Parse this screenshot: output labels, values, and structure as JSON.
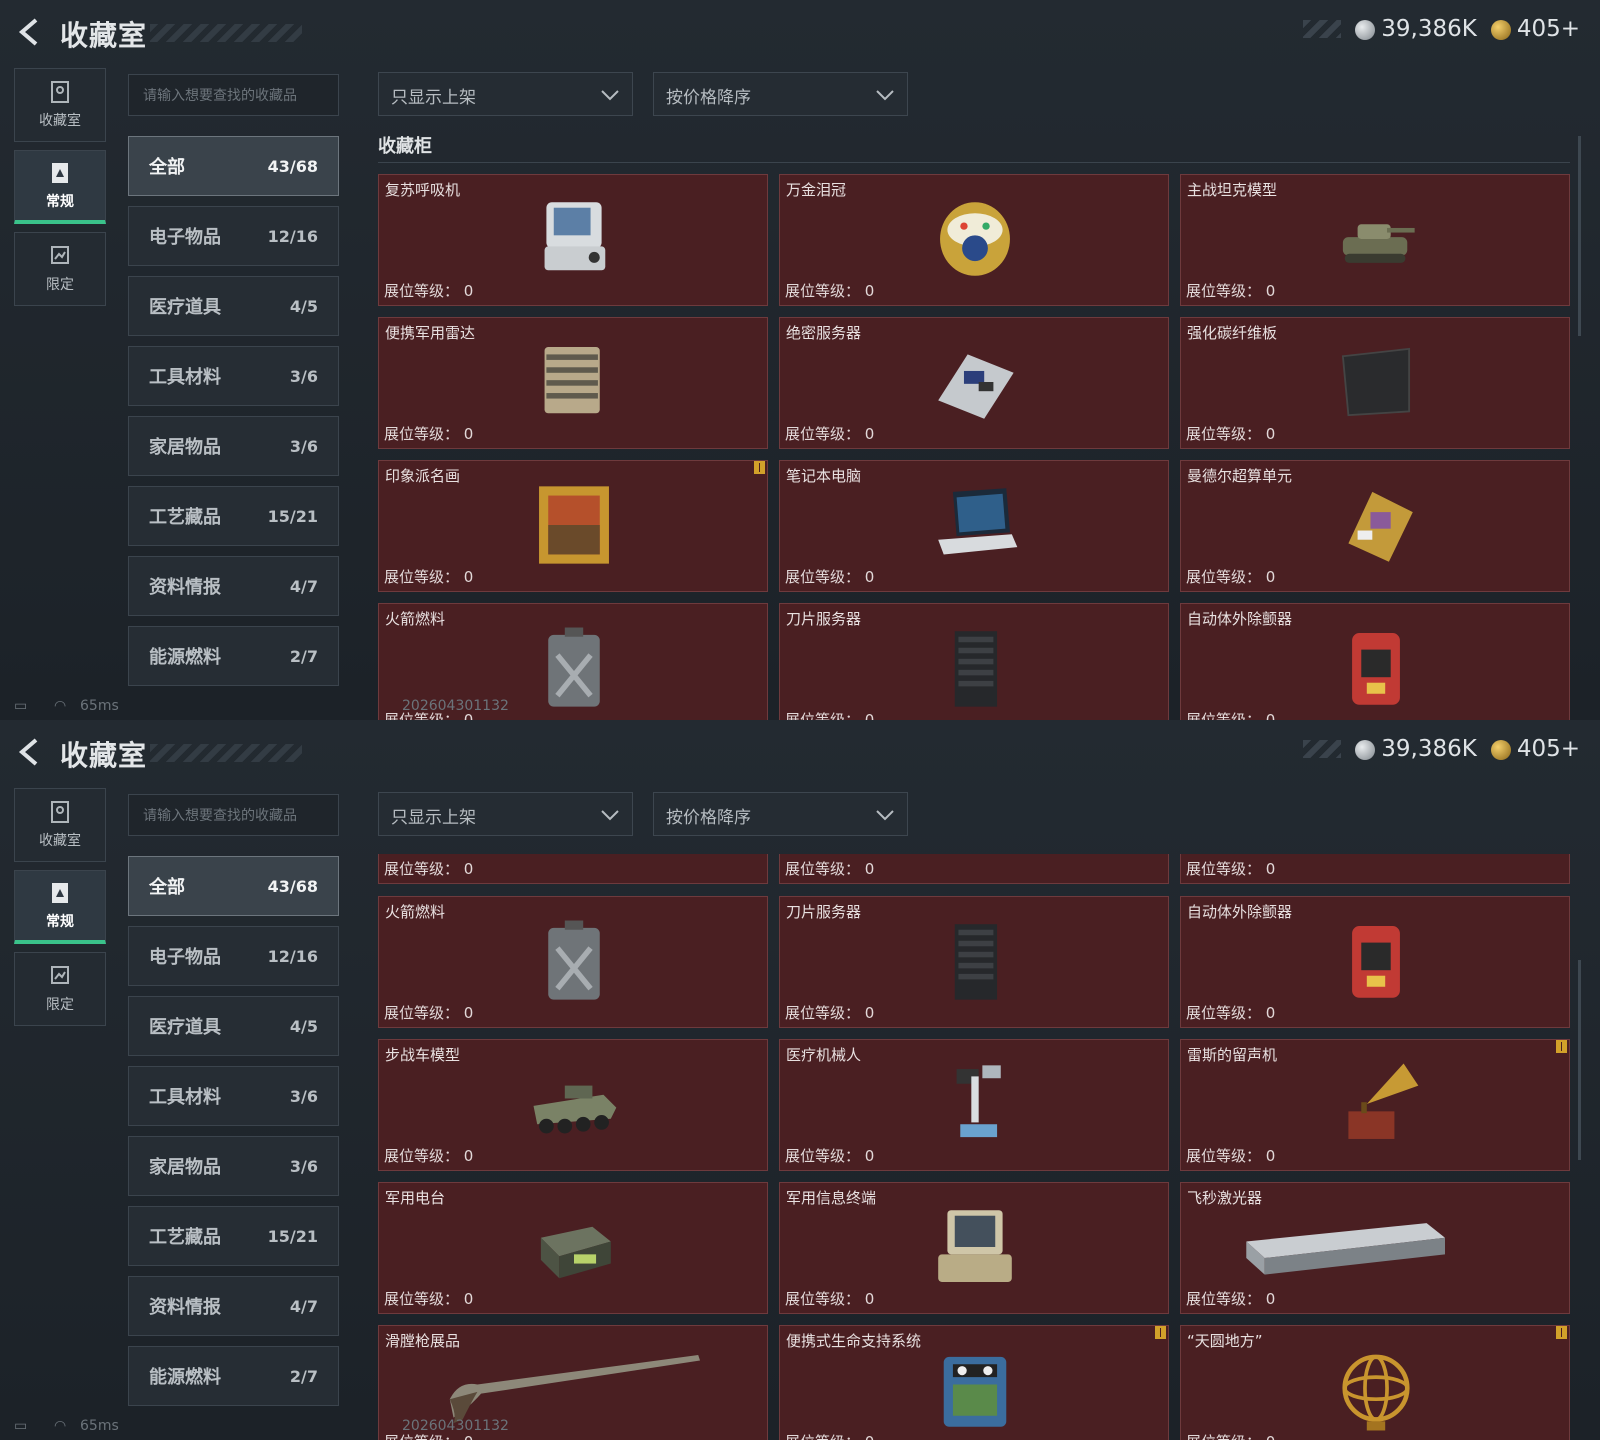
{
  "top": {
    "title": "收藏室",
    "currency_silver": "39,386K",
    "currency_gold": "405+"
  },
  "nav": [
    {
      "label": "收藏室",
      "icon": "collection-room-icon"
    },
    {
      "label": "常规",
      "icon": "regular-icon"
    },
    {
      "label": "限定",
      "icon": "limited-icon"
    }
  ],
  "search": {
    "placeholder": "请输入想要查找的收藏品"
  },
  "filters": {
    "shelf": "只显示上架",
    "sort": "按价格降序"
  },
  "categories": [
    {
      "label": "全部",
      "count": "43/68"
    },
    {
      "label": "电子物品",
      "count": "12/16"
    },
    {
      "label": "医疗道具",
      "count": "4/5"
    },
    {
      "label": "工具材料",
      "count": "3/6"
    },
    {
      "label": "家居物品",
      "count": "3/6"
    },
    {
      "label": "工艺藏品",
      "count": "15/21"
    },
    {
      "label": "资料情报",
      "count": "4/7"
    },
    {
      "label": "能源燃料",
      "count": "2/7"
    }
  ],
  "section_title": "收藏柜",
  "level_label": "展位等级：",
  "level_value": "0",
  "items_top": [
    {
      "name": "复苏呼吸机",
      "icon": "ventilator-icon"
    },
    {
      "name": "万金泪冠",
      "icon": "jeweled-egg-icon"
    },
    {
      "name": "主战坦克模型",
      "icon": "tank-model-icon"
    },
    {
      "name": "便携军用雷达",
      "icon": "radar-icon"
    },
    {
      "name": "绝密服务器",
      "icon": "server-board-icon"
    },
    {
      "name": "强化碳纤维板",
      "icon": "carbon-plate-icon"
    },
    {
      "name": "印象派名画",
      "icon": "painting-icon",
      "mark": true
    },
    {
      "name": "笔记本电脑",
      "icon": "laptop-icon"
    },
    {
      "name": "曼德尔超算单元",
      "icon": "supercomputer-unit-icon"
    },
    {
      "name": "火箭燃料",
      "icon": "fuel-can-icon"
    },
    {
      "name": "刀片服务器",
      "icon": "blade-server-icon"
    },
    {
      "name": "自动体外除颤器",
      "icon": "defibrillator-icon"
    }
  ],
  "items_bottom": [
    {
      "name": "火箭燃料",
      "icon": "fuel-can-icon"
    },
    {
      "name": "刀片服务器",
      "icon": "blade-server-icon"
    },
    {
      "name": "自动体外除颤器",
      "icon": "defibrillator-icon"
    },
    {
      "name": "步战车模型",
      "icon": "ifv-model-icon"
    },
    {
      "name": "医疗机械人",
      "icon": "medical-robot-icon"
    },
    {
      "name": "雷斯的留声机",
      "icon": "gramophone-icon",
      "mark": true
    },
    {
      "name": "军用电台",
      "icon": "military-radio-icon"
    },
    {
      "name": "军用信息终端",
      "icon": "field-terminal-icon"
    },
    {
      "name": "飞秒激光器",
      "icon": "laser-device-icon"
    },
    {
      "name": "滑膛枪展品",
      "icon": "musket-icon"
    },
    {
      "name": "便携式生命支持系统",
      "icon": "life-support-icon",
      "mark": true
    },
    {
      "name": "“天圆地方”",
      "icon": "armillary-sphere-icon",
      "mark": true
    }
  ],
  "status": {
    "ping": "65ms",
    "build": "202604301132"
  },
  "colors": {
    "card_bg": "#4a1f22",
    "accent": "#3ac28a",
    "mark": "#d2a12a"
  }
}
